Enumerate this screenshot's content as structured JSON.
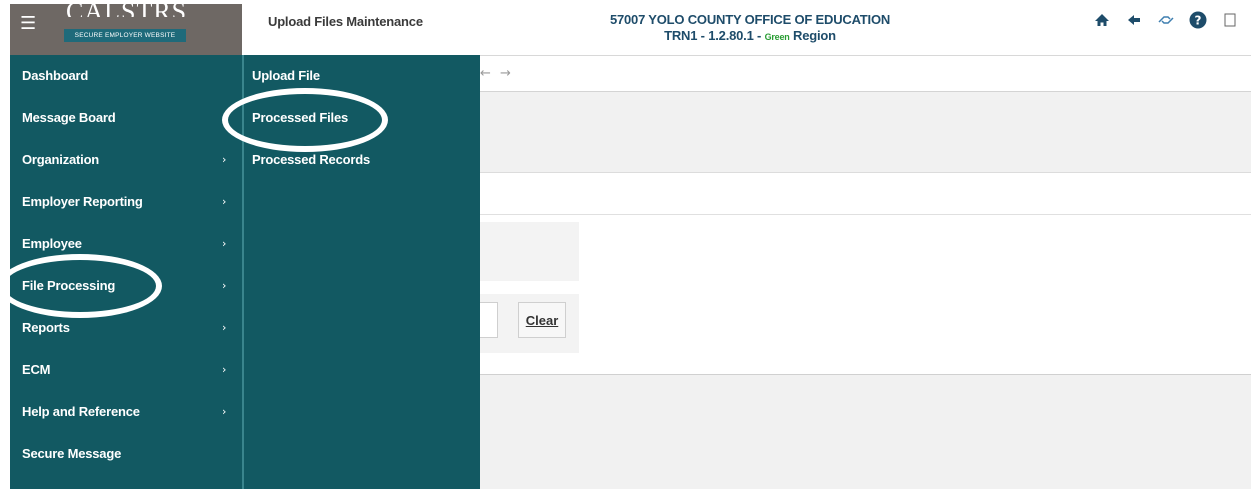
{
  "header": {
    "brand": "CALSTRS",
    "brand_sub": "SECURE EMPLOYER WEBSITE",
    "page_title": "Upload Files Maintenance",
    "org": "57007 YOLO COUNTY OFFICE OF EDUCATION",
    "env_prefix": "TRN1 - 1.2.80.1 - ",
    "env_color_word": "Green",
    "env_suffix": " Region",
    "icons": [
      "home-icon",
      "back-arrow-icon",
      "link-icon",
      "help-icon",
      "window-icon"
    ]
  },
  "menu": {
    "items": [
      {
        "label": "Dashboard",
        "has_submenu": false
      },
      {
        "label": "Message Board",
        "has_submenu": false
      },
      {
        "label": "Organization",
        "has_submenu": true
      },
      {
        "label": "Employer Reporting",
        "has_submenu": true
      },
      {
        "label": "Employee",
        "has_submenu": true
      },
      {
        "label": "File Processing",
        "has_submenu": true
      },
      {
        "label": "Reports",
        "has_submenu": true
      },
      {
        "label": "ECM",
        "has_submenu": true
      },
      {
        "label": "Help and Reference",
        "has_submenu": true
      },
      {
        "label": "Secure Message",
        "has_submenu": false
      }
    ],
    "chevron": "›"
  },
  "submenu": {
    "items": [
      {
        "label": "Upload File"
      },
      {
        "label": "Processed Files"
      },
      {
        "label": "Processed Records"
      }
    ]
  },
  "content": {
    "clear_label": "Clear"
  },
  "colors": {
    "menu_bg": "#125962",
    "header_logo_bg": "#6e6864",
    "org_text": "#1e4c6a",
    "env_green": "#2a9d34",
    "annotation": "#ffffff"
  }
}
